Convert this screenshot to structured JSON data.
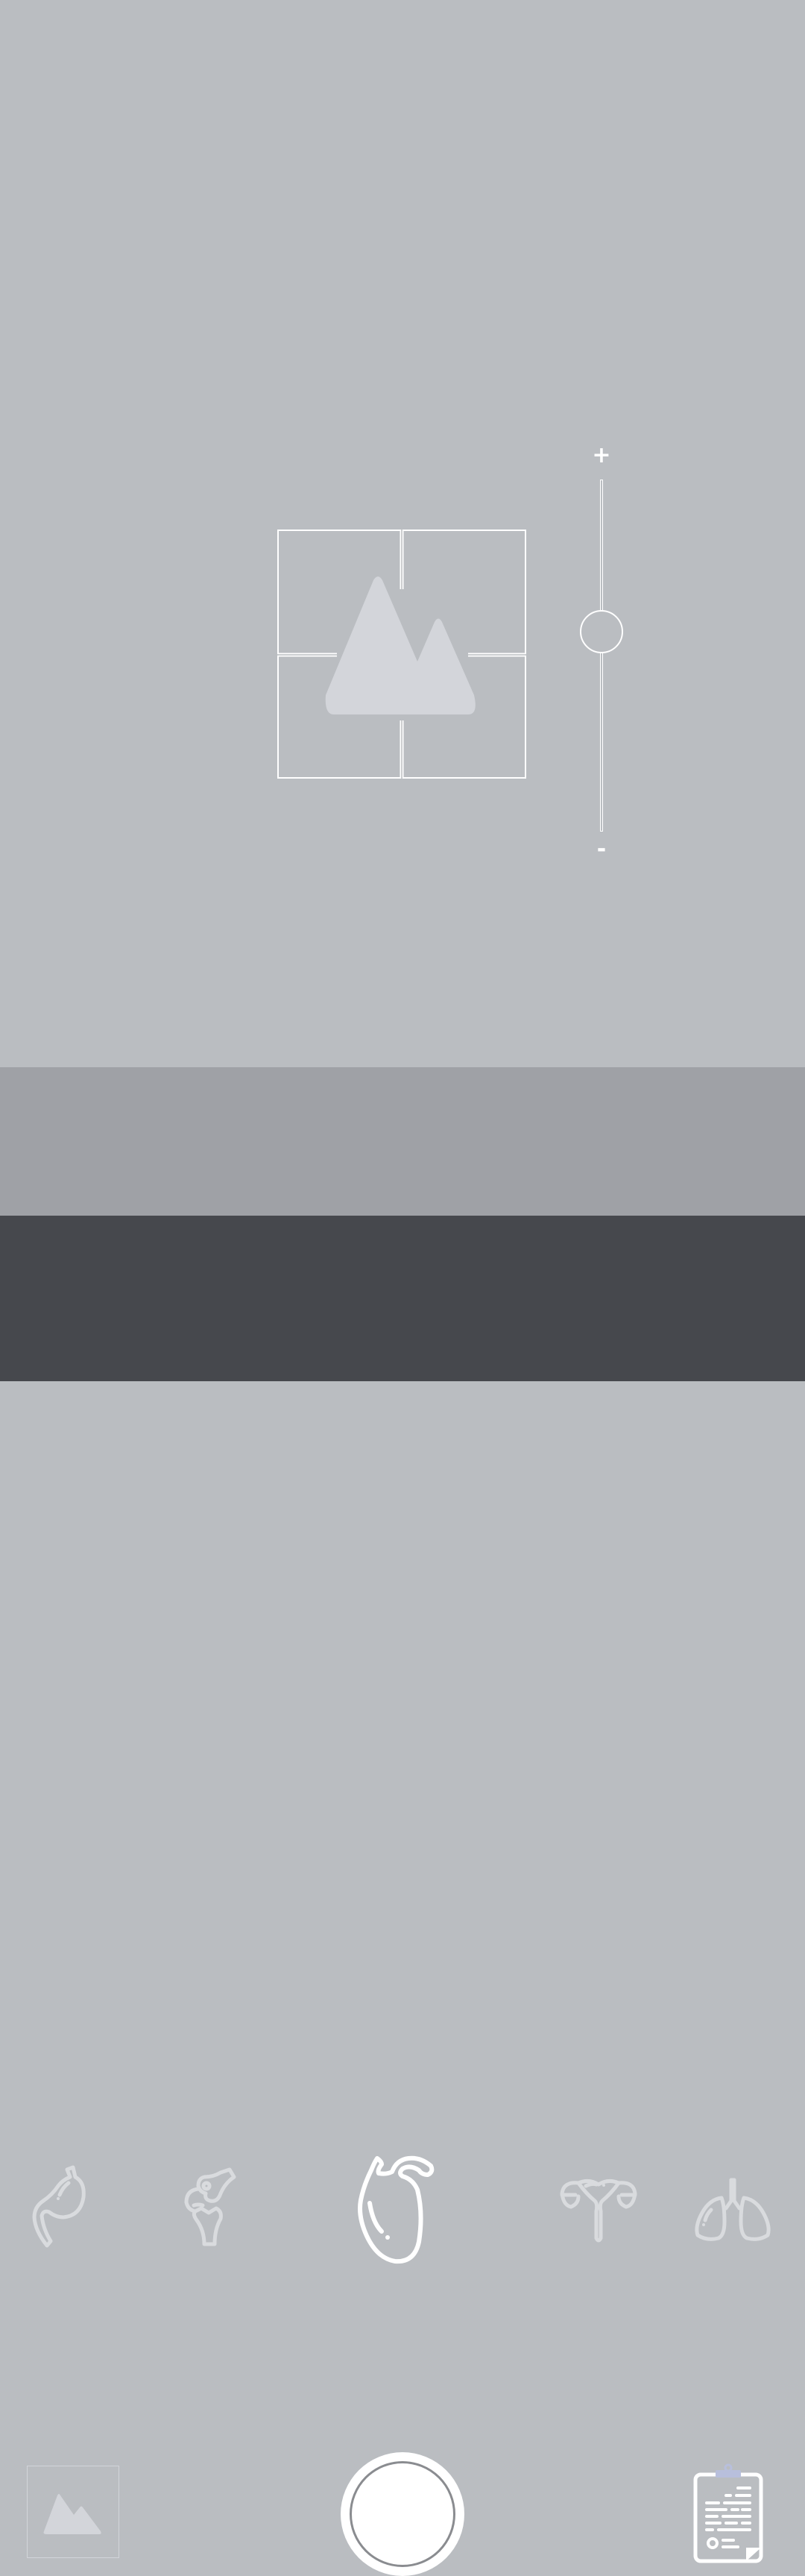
{
  "zoom": {
    "plus_label": "+",
    "minus_label": "-",
    "level": 0.5
  },
  "organ_selector": {
    "items": [
      "stomach-icon",
      "knee-joint-icon",
      "heart-icon",
      "uterus-icon",
      "lungs-icon"
    ],
    "selected": "heart-icon"
  },
  "icons": {
    "placeholder": "mountain-image-icon",
    "gallery": "gallery-thumbnail-icon",
    "report": "clipboard-report-icon"
  },
  "colors": {
    "viewfinder": "#babdc1",
    "organ_bar": "#9fa1a6",
    "bottom_bar": "#46484d",
    "icon_inactive": "#d9dbde",
    "icon_active": "#ffffff",
    "clip_accent": "#b8bfdc"
  }
}
